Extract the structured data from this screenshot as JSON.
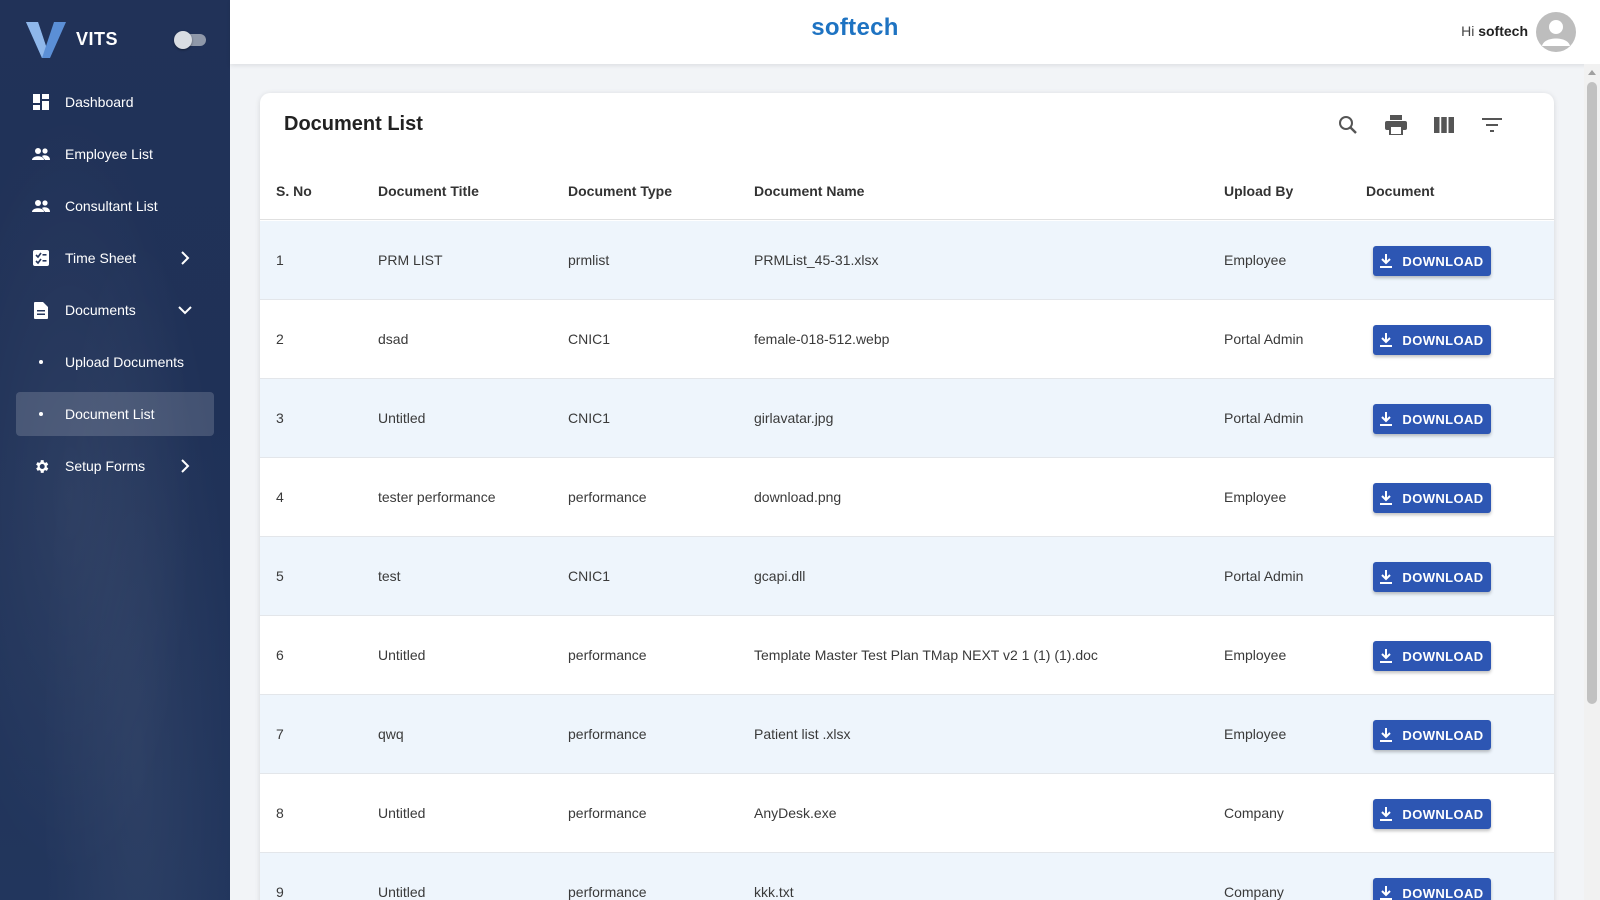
{
  "app": {
    "name": "VITS",
    "company": "softech",
    "greeting_prefix": "Hi",
    "user": "softech"
  },
  "sidebar": {
    "items": [
      {
        "label": "Dashboard",
        "icon": "dashboard-icon"
      },
      {
        "label": "Employee List",
        "icon": "people-icon"
      },
      {
        "label": "Consultant List",
        "icon": "people-icon"
      },
      {
        "label": "Time Sheet",
        "icon": "timesheet-icon",
        "chevron": "right"
      },
      {
        "label": "Documents",
        "icon": "document-icon",
        "chevron": "down"
      },
      {
        "label": "Upload Documents",
        "sub": true
      },
      {
        "label": "Document List",
        "sub": true,
        "active": true
      },
      {
        "label": "Setup Forms",
        "icon": "gear-icon",
        "chevron": "right"
      }
    ]
  },
  "card": {
    "title": "Document List",
    "tools": [
      "search-icon",
      "print-icon",
      "view-columns-icon",
      "filter-icon"
    ]
  },
  "table": {
    "headers": [
      "S. No",
      "Document Title",
      "Document Type",
      "Document Name",
      "Upload By",
      "Document"
    ],
    "download_label": "DOWNLOAD",
    "rows": [
      {
        "sno": "1",
        "title": "PRM LIST",
        "type": "prmlist",
        "name": "PRMList_45-31.xlsx",
        "by": "Employee"
      },
      {
        "sno": "2",
        "title": "dsad",
        "type": "CNIC1",
        "name": "female-018-512.webp",
        "by": "Portal Admin"
      },
      {
        "sno": "3",
        "title": "Untitled",
        "type": "CNIC1",
        "name": "girlavatar.jpg",
        "by": "Portal Admin"
      },
      {
        "sno": "4",
        "title": "tester performance",
        "type": "performance",
        "name": "download.png",
        "by": "Employee"
      },
      {
        "sno": "5",
        "title": "test",
        "type": "CNIC1",
        "name": "gcapi.dll",
        "by": "Portal Admin"
      },
      {
        "sno": "6",
        "title": "Untitled",
        "type": "performance",
        "name": "Template Master Test Plan TMap NEXT v2 1 (1) (1).doc",
        "by": "Employee"
      },
      {
        "sno": "7",
        "title": "qwq",
        "type": "performance",
        "name": "Patient list .xlsx",
        "by": "Employee"
      },
      {
        "sno": "8",
        "title": "Untitled",
        "type": "performance",
        "name": "AnyDesk.exe",
        "by": "Company"
      },
      {
        "sno": "9",
        "title": "Untitled",
        "type": "performance",
        "name": "kkk.txt",
        "by": "Company"
      }
    ]
  },
  "colors": {
    "sidebar_bg": "#213258",
    "brand_text": "#1e73c2",
    "download_button": "#2d56b3",
    "row_alt": "#eef5fc"
  }
}
